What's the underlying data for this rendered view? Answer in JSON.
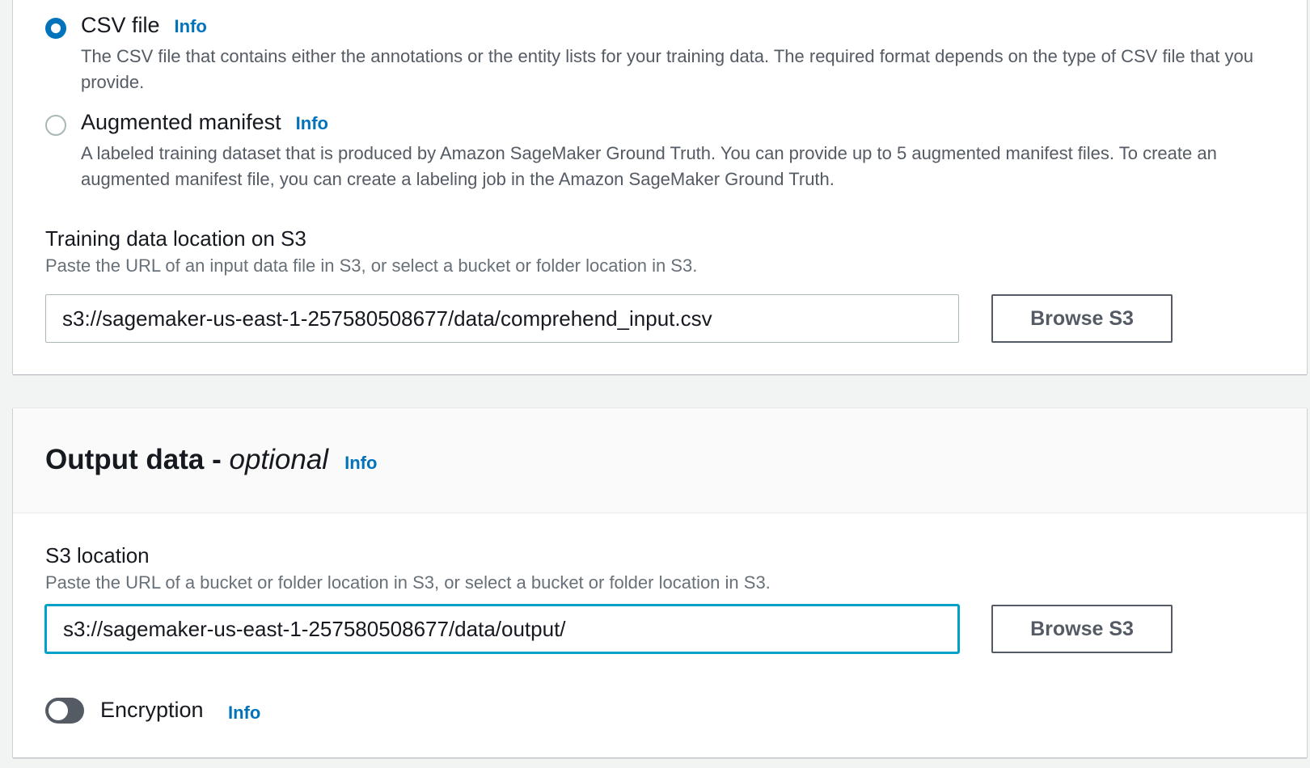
{
  "input_format": {
    "options": [
      {
        "label": "CSV file",
        "info": "Info",
        "description": "The CSV file that contains either the annotations or the entity lists for your training data. The required format depends on the type of CSV file that you provide.",
        "selected": true
      },
      {
        "label": "Augmented manifest",
        "info": "Info",
        "description": "A labeled training dataset that is produced by Amazon SageMaker Ground Truth. You can provide up to 5 augmented manifest files. To create an augmented manifest file, you can create a labeling job in the Amazon SageMaker Ground Truth.",
        "selected": false
      }
    ]
  },
  "training_location": {
    "label": "Training data location on S3",
    "description": "Paste the URL of an input data file in S3, or select a bucket or folder location in S3.",
    "value": "s3://sagemaker-us-east-1-257580508677/data/comprehend_input.csv",
    "browse_label": "Browse S3"
  },
  "output_data": {
    "title": "Output data -",
    "title_optional": "optional",
    "info": "Info",
    "s3_location": {
      "label": "S3 location",
      "description": "Paste the URL of a bucket or folder location in S3, or select a bucket or folder location in S3.",
      "value": "s3://sagemaker-us-east-1-257580508677/data/output/",
      "browse_label": "Browse S3"
    },
    "encryption": {
      "label": "Encryption",
      "info": "Info",
      "enabled": false
    }
  },
  "colors": {
    "accent": "#0073bb",
    "focus": "#00a1c9",
    "background": "#f2f3f3"
  }
}
